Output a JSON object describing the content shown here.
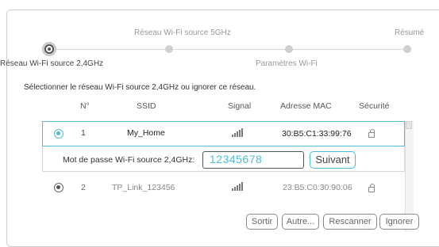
{
  "wizard": {
    "steps": [
      {
        "label": "Réseau Wi-Fi source 2,4GHz",
        "active": true
      },
      {
        "label": "Réseau Wi-Fi source 5GHz",
        "active": false
      },
      {
        "label": "Paramètres Wi-Fi",
        "active": false
      },
      {
        "label": "Résumé",
        "active": false
      }
    ]
  },
  "instruction": "Sélectionner le réseau Wi-Fi source 2,4GHz ou ignorer ce réseau.",
  "table": {
    "headers": {
      "no": "N°",
      "ssid": "SSID",
      "signal": "Signal",
      "mac": "Adresse MAC",
      "security": "Sécurité"
    },
    "rows": [
      {
        "no": "1",
        "ssid": "My_Home",
        "mac": "30:B5:C1:33:99:76",
        "selected": true
      },
      {
        "no": "2",
        "ssid": "TP_Link_123456",
        "mac": "23:B5:C0:30:90:06",
        "selected": false
      }
    ]
  },
  "password": {
    "label": "Mot de passe Wi-Fi source 2,4GHz:",
    "value": "12345678",
    "next_label": "Suivant"
  },
  "footer": {
    "exit_label": "Sortir",
    "other_label": "Autre...",
    "rescan_label": "Rescanner",
    "ignore_label": "Ignorer"
  },
  "colors": {
    "accent": "#4dbdd6",
    "border": "#cfcfcf"
  }
}
